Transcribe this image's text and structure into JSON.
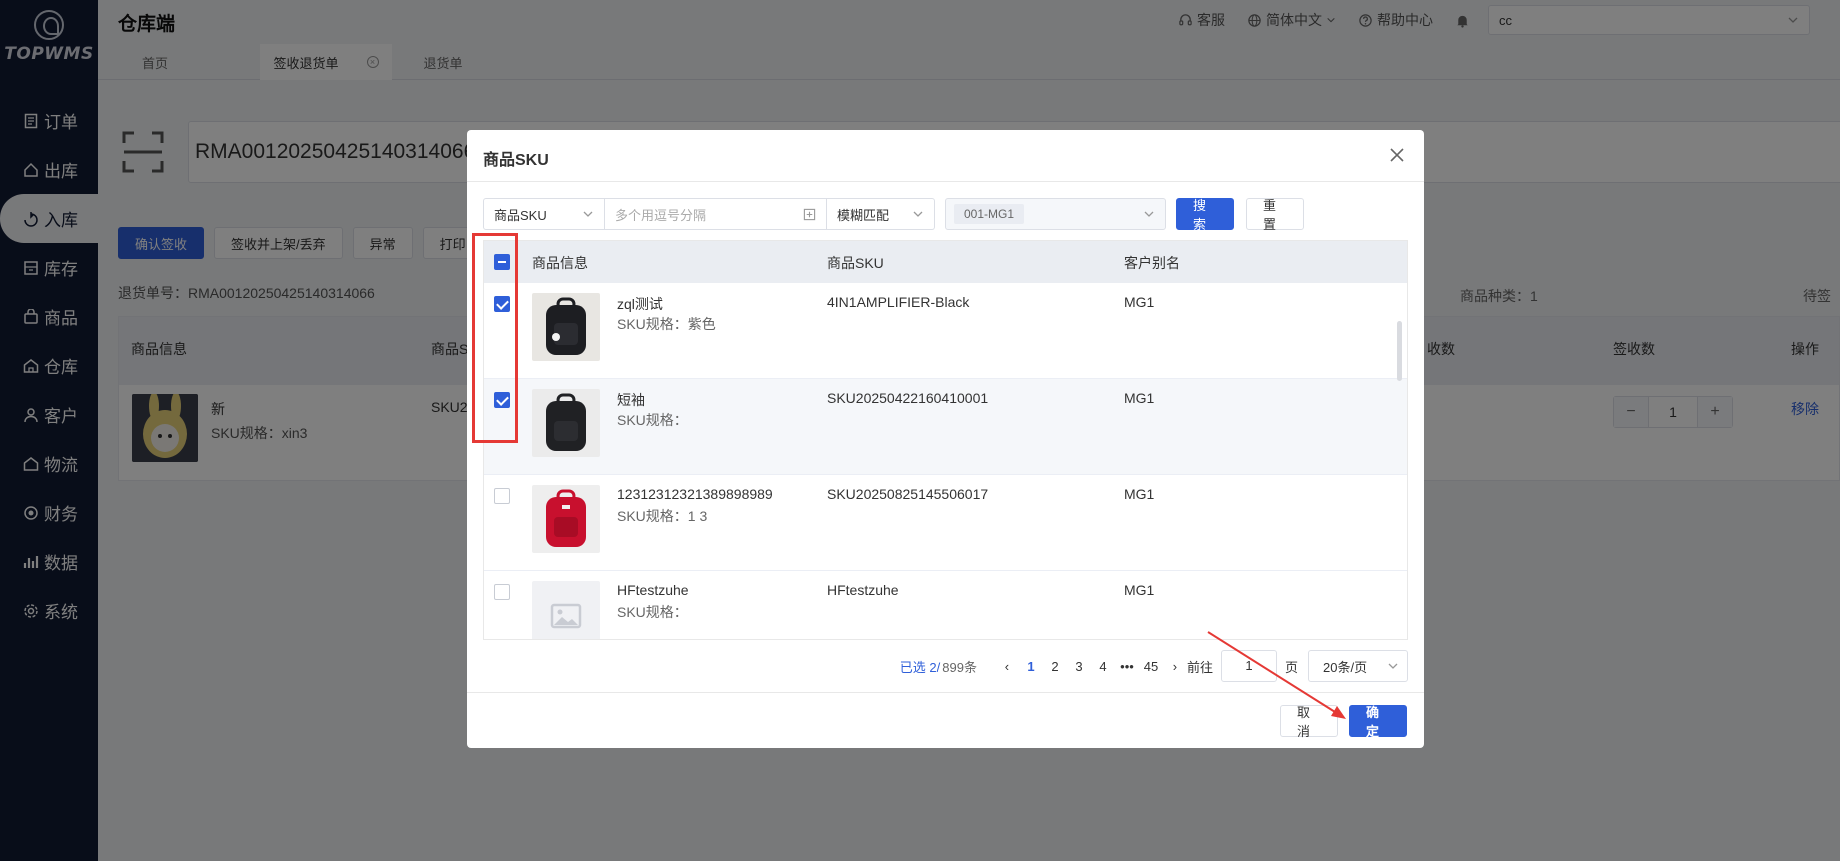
{
  "app": {
    "logo_text": "TOPWMS",
    "title": "仓库端"
  },
  "sidebar": {
    "items": [
      {
        "label": "订单",
        "icon": "order-icon"
      },
      {
        "label": "出库",
        "icon": "outbound-icon"
      },
      {
        "label": "入库",
        "icon": "inbound-icon",
        "active": true
      },
      {
        "label": "库存",
        "icon": "inventory-icon"
      },
      {
        "label": "商品",
        "icon": "product-icon"
      },
      {
        "label": "仓库",
        "icon": "warehouse-icon"
      },
      {
        "label": "客户",
        "icon": "customer-icon"
      },
      {
        "label": "物流",
        "icon": "logistics-icon"
      },
      {
        "label": "财务",
        "icon": "finance-icon"
      },
      {
        "label": "数据",
        "icon": "data-icon"
      },
      {
        "label": "系统",
        "icon": "system-icon"
      }
    ]
  },
  "header": {
    "service": "客服",
    "language": "简体中文",
    "help": "帮助中心",
    "user": "cc"
  },
  "tabs": [
    {
      "label": "首页"
    },
    {
      "label": "签收退货单",
      "active": true
    },
    {
      "label": "退货单"
    }
  ],
  "page": {
    "rma_input": "RMA00120250425140314066",
    "buttons": {
      "confirm": "确认签收",
      "shelf_discard": "签收并上架/丢弃",
      "exception": "异常",
      "print": "打印"
    },
    "return_no_label": "退货单号：",
    "return_no": "RMA00120250425140314066",
    "kind_label": "商品种类：",
    "kind_count": "1",
    "pending_label": "待签",
    "table_headers": {
      "info": "商品信息",
      "sku": "商品S",
      "count": "收数",
      "signed": "签收数",
      "action": "操作"
    },
    "row": {
      "name": "新",
      "spec": "SKU规格：xin3",
      "sku": "SKU2",
      "qty": "1",
      "remove": "移除"
    }
  },
  "modal": {
    "title": "商品SKU",
    "filter": {
      "field": "商品SKU",
      "input_placeholder": "多个用逗号分隔",
      "match": "模糊匹配",
      "customer_tag": "001-MG1",
      "search": "搜索",
      "reset": "重置"
    },
    "table": {
      "headers": {
        "info": "商品信息",
        "sku": "商品SKU",
        "alias": "客户别名"
      },
      "rows": [
        {
          "name": "zql测试",
          "spec": "SKU规格：紫色",
          "sku": "4IN1AMPLIFIER-Black",
          "alias": "MG1",
          "checked": true
        },
        {
          "name": "短袖",
          "spec": "SKU规格：",
          "sku": "SKU20250422160410001",
          "alias": "MG1",
          "checked": true
        },
        {
          "name": "12312312321389898989",
          "spec": "SKU规格：1 3",
          "sku": "SKU20250825145506017",
          "alias": "MG1",
          "checked": false
        },
        {
          "name": "HFtestzuhe",
          "spec": "SKU规格：",
          "sku": "HFtestzuhe",
          "alias": "MG1",
          "checked": false
        }
      ]
    },
    "pagination": {
      "selected": "已选 2/",
      "total": " 899条",
      "pages": [
        "1",
        "2",
        "3",
        "4",
        "•••",
        "45"
      ],
      "current": "1",
      "goto_label": "前往",
      "goto_value": "1",
      "page_unit": "页",
      "page_size": "20条/页"
    },
    "footer": {
      "cancel": "取消",
      "ok": "确定"
    }
  },
  "colors": {
    "primary": "#2f5fd9",
    "sidebar_bg": "#111a33",
    "annotation": "#e53935"
  }
}
